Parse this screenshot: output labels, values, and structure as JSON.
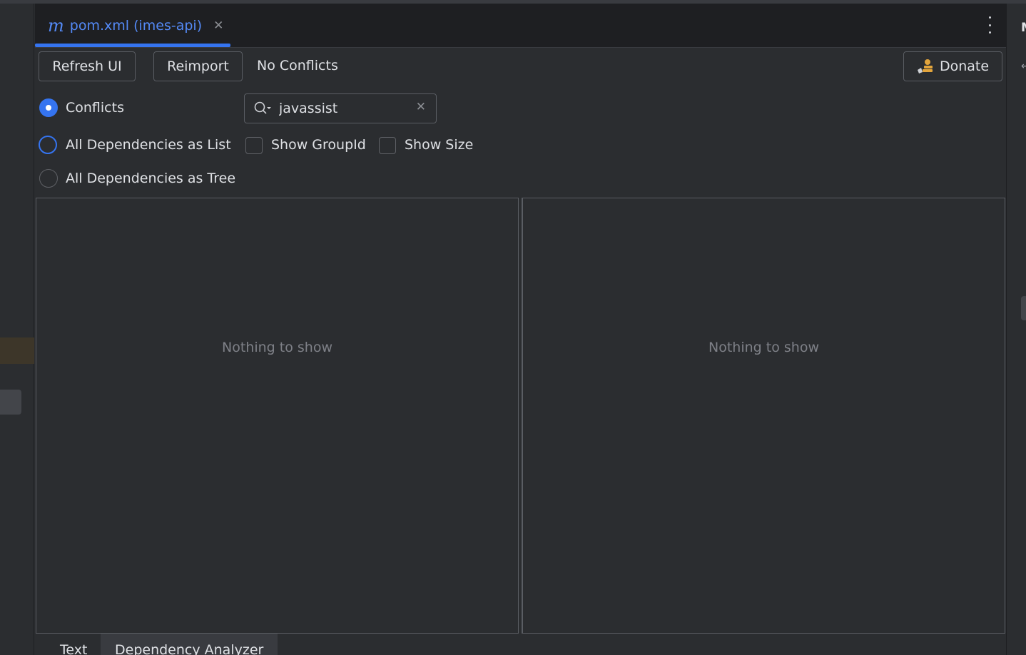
{
  "editor_tab": {
    "icon": "maven-m-icon",
    "glyph": "m",
    "label": "pom.xml (imes-api)",
    "close_glyph": "✕"
  },
  "toolbar": {
    "refresh_label": "Refresh UI",
    "reimport_label": "Reimport",
    "status_text": "No Conflicts",
    "donate_label": "Donate",
    "donate_icon": "coin-stack-icon"
  },
  "view_mode": {
    "options": [
      {
        "label": "Conflicts",
        "selected": true
      },
      {
        "label": "All Dependencies as List",
        "selected": false
      },
      {
        "label": "All Dependencies as Tree",
        "selected": false
      }
    ]
  },
  "search": {
    "value": "javassist",
    "clear_glyph": "✕"
  },
  "options": {
    "show_groupid_label": "Show GroupId",
    "show_groupid_checked": false,
    "show_size_label": "Show Size",
    "show_size_checked": false
  },
  "left_panel": {
    "empty_text": "Nothing to show"
  },
  "right_panel": {
    "empty_text": "Nothing to show"
  },
  "right_strip": {
    "initial": "M",
    "arrow_glyph": "↵"
  },
  "bottom_tabs": [
    {
      "label": "Text",
      "active": false
    },
    {
      "label": "Dependency Analyzer",
      "active": true
    }
  ],
  "colors": {
    "accent": "#3574f0",
    "link_blue": "#548af7",
    "background": "#2b2d30",
    "tabbar": "#1e1f22"
  }
}
